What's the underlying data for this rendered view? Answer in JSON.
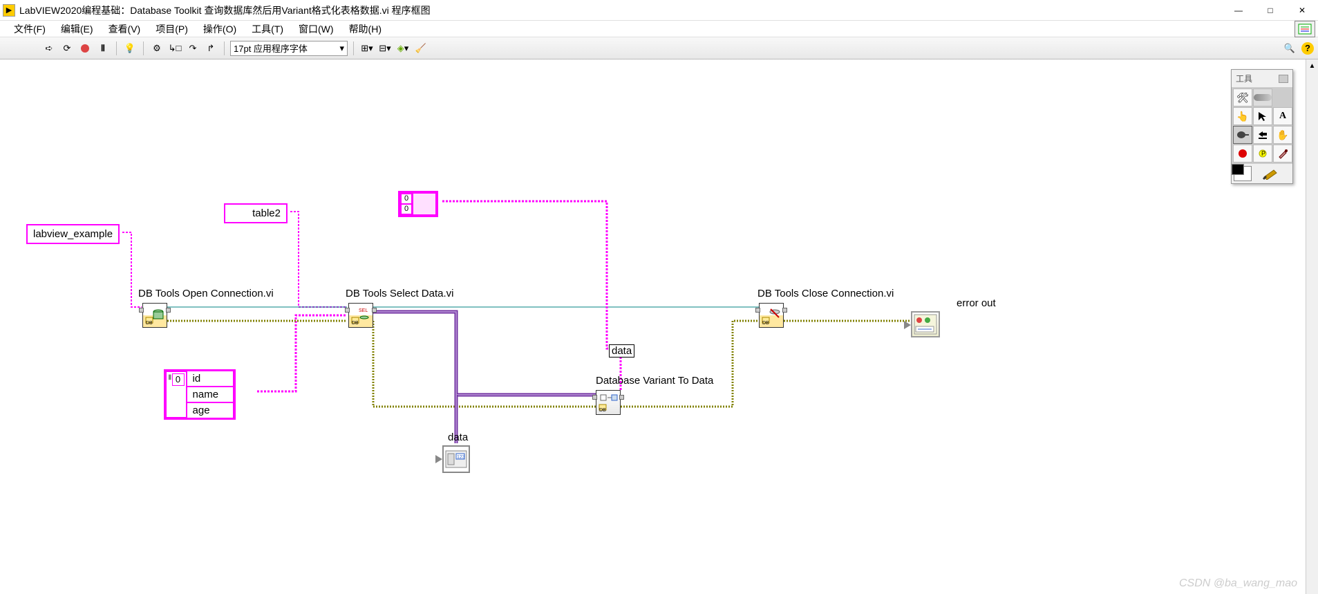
{
  "window": {
    "title": "LabVIEW2020编程基础：Database Toolkit 查询数据库然后用Variant格式化表格数据.vi 程序框图"
  },
  "menu": {
    "file": "文件(F)",
    "edit": "编辑(E)",
    "view": "查看(V)",
    "project": "项目(P)",
    "operate": "操作(O)",
    "tools": "工具(T)",
    "window": "窗口(W)",
    "help": "帮助(H)"
  },
  "toolbar": {
    "font": "17pt 应用程序字体"
  },
  "nodes": {
    "conn_str": "labview_example",
    "table_name": "table2",
    "open_label": "DB Tools Open Connection.vi",
    "select_label": "DB Tools Select Data.vi",
    "close_label": "DB Tools Close Connection.vi",
    "variant_label": "Database Variant To Data",
    "error_label": "error out",
    "data_label": "data",
    "data_ind_label": "data",
    "columns_idx": "0",
    "columns": [
      "id",
      "name",
      "age"
    ],
    "arr2d_idx1": "0",
    "arr2d_idx2": "0"
  },
  "palette": {
    "title": "工具"
  },
  "watermark": "CSDN @ba_wang_mao"
}
